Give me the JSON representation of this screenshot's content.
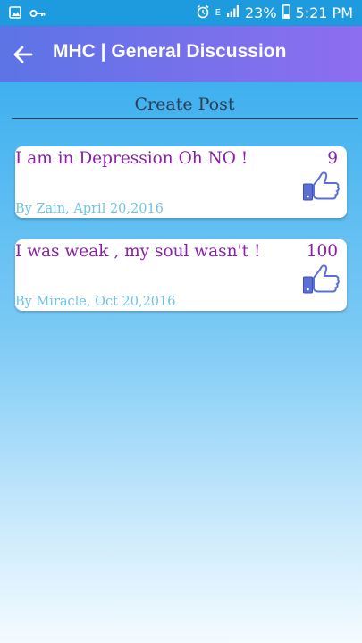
{
  "status_bar": {
    "battery": "23%",
    "time": "5:21 PM",
    "network": "E"
  },
  "app_bar": {
    "title": "MHC | General Discussion"
  },
  "create_post": {
    "label": "Create Post"
  },
  "posts": [
    {
      "title": "I am in Depression Oh NO !",
      "likes": "9",
      "author": "By Zain, April 20,2016"
    },
    {
      "title": "I was weak , my soul wasn't !",
      "likes": "100",
      "author": "By Miracle, Oct 20,2016"
    }
  ],
  "colors": {
    "app_bar_start": "#5c74e6",
    "app_bar_end": "#8d6ef0",
    "post_text": "#8b1fa9",
    "author_text": "#6fc3e6",
    "like_icon": "#5a6fd8"
  }
}
